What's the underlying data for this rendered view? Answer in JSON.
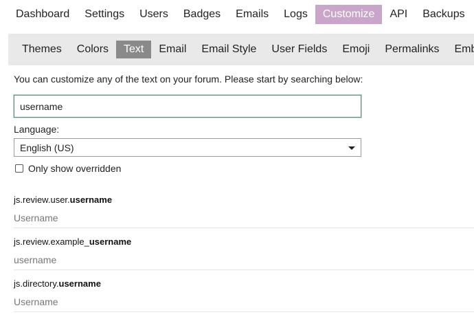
{
  "top_nav": [
    {
      "label": "Dashboard",
      "active": false
    },
    {
      "label": "Settings",
      "active": false
    },
    {
      "label": "Users",
      "active": false
    },
    {
      "label": "Badges",
      "active": false
    },
    {
      "label": "Emails",
      "active": false
    },
    {
      "label": "Logs",
      "active": false
    },
    {
      "label": "Customize",
      "active": true
    },
    {
      "label": "API",
      "active": false
    },
    {
      "label": "Backups",
      "active": false
    }
  ],
  "sub_nav": [
    {
      "label": "Themes",
      "active": false
    },
    {
      "label": "Colors",
      "active": false
    },
    {
      "label": "Text",
      "active": true
    },
    {
      "label": "Email",
      "active": false
    },
    {
      "label": "Email Style",
      "active": false
    },
    {
      "label": "User Fields",
      "active": false
    },
    {
      "label": "Emoji",
      "active": false
    },
    {
      "label": "Permalinks",
      "active": false
    },
    {
      "label": "Embedding",
      "active": false
    }
  ],
  "intro_text": "You can customize any of the text on your forum. Please start by searching below:",
  "search": {
    "value": "username",
    "placeholder": ""
  },
  "language": {
    "label": "Language:",
    "selected": "English (US)"
  },
  "only_overridden": {
    "label": "Only show overridden",
    "checked": false
  },
  "results": [
    {
      "key_prefix": "js.review.user.",
      "key_match": "username",
      "key_suffix": "",
      "value": "Username"
    },
    {
      "key_prefix": "js.review.example_",
      "key_match": "username",
      "key_suffix": "",
      "value": "username"
    },
    {
      "key_prefix": "js.directory.",
      "key_match": "username",
      "key_suffix": "",
      "value": "Username"
    }
  ],
  "colors": {
    "active_top": "#c9a6c9",
    "active_sub": "#8a8a8a",
    "search_border": "#5f8f78"
  }
}
